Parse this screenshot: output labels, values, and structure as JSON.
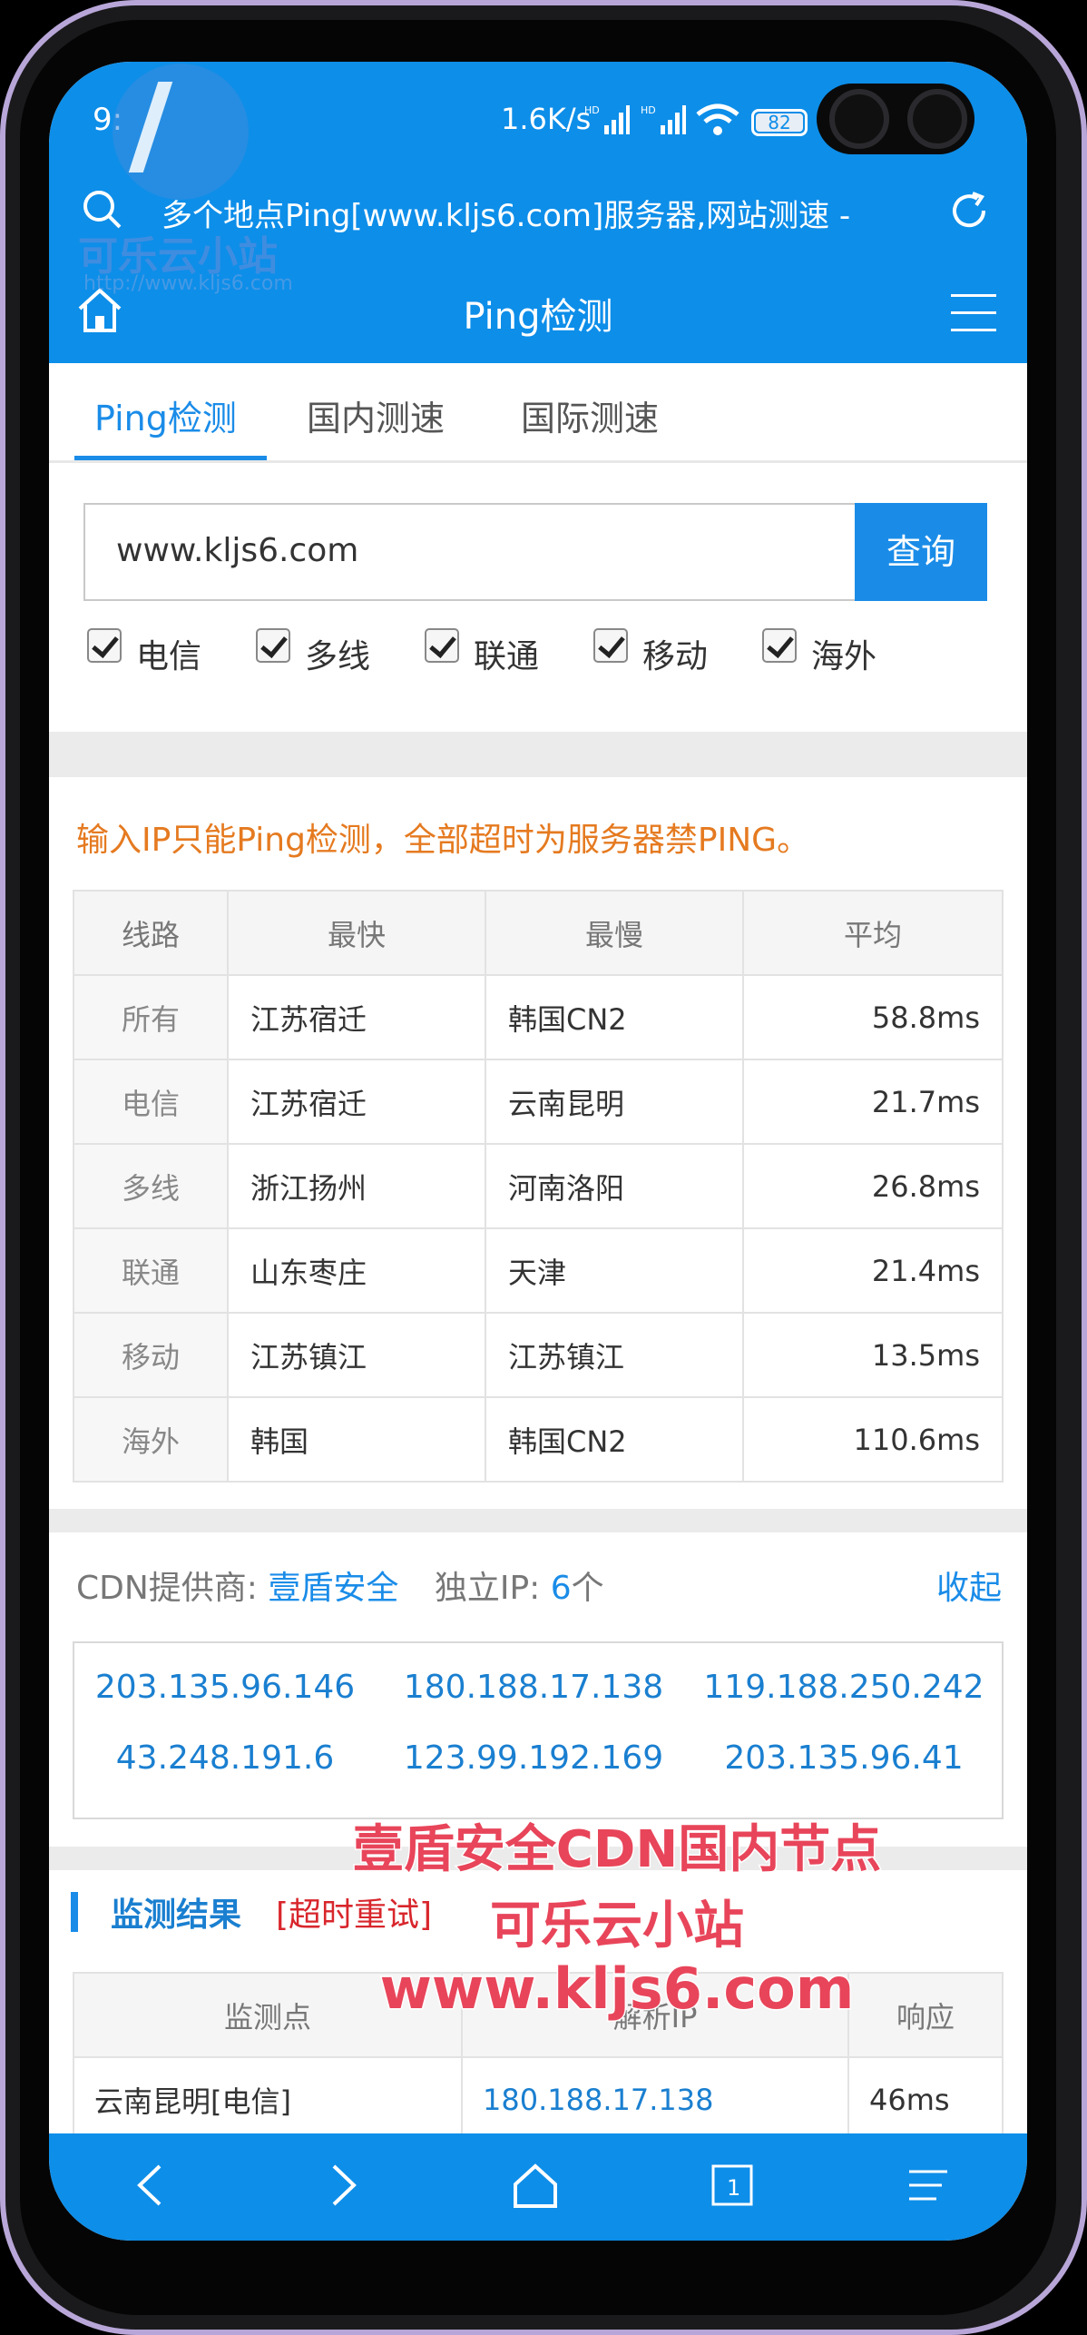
{
  "status_bar": {
    "time": "9:",
    "net_speed": "1.6K/s",
    "battery": "82"
  },
  "url_bar": {
    "text": "多个地点Ping[www.kljs6.com]服务器,网站测速 -"
  },
  "nav": {
    "title": "Ping检测"
  },
  "tabs": [
    {
      "label": "Ping检测",
      "active": true
    },
    {
      "label": "国内测速",
      "active": false
    },
    {
      "label": "国际测速",
      "active": false
    }
  ],
  "search": {
    "value": "www.kljs6.com",
    "button": "查询"
  },
  "checkboxes": [
    {
      "label": "电信",
      "checked": true
    },
    {
      "label": "多线",
      "checked": true
    },
    {
      "label": "联通",
      "checked": true
    },
    {
      "label": "移动",
      "checked": true
    },
    {
      "label": "海外",
      "checked": true
    }
  ],
  "notice": "输入IP只能Ping检测，全部超时为服务器禁PING。",
  "result_table": {
    "headers": [
      "线路",
      "最快",
      "最慢",
      "平均"
    ],
    "rows": [
      [
        "所有",
        "江苏宿迁",
        "韩国CN2",
        "58.8ms"
      ],
      [
        "电信",
        "江苏宿迁",
        "云南昆明",
        "21.7ms"
      ],
      [
        "多线",
        "浙江扬州",
        "河南洛阳",
        "26.8ms"
      ],
      [
        "联通",
        "山东枣庄",
        "天津",
        "21.4ms"
      ],
      [
        "移动",
        "江苏镇江",
        "江苏镇江",
        "13.5ms"
      ],
      [
        "海外",
        "韩国",
        "韩国CN2",
        "110.6ms"
      ]
    ]
  },
  "cdn": {
    "label": "CDN提供商:",
    "provider": "壹盾安全",
    "ip_label": "独立IP:",
    "ip_count": "6",
    "ip_unit": "个",
    "collapse": "收起",
    "ips": [
      "203.135.96.146",
      "180.188.17.138",
      "119.188.250.242",
      "43.248.191.6",
      "123.99.192.169",
      "203.135.96.41"
    ]
  },
  "monitor": {
    "title": "监测结果",
    "retry": "[超时重试]",
    "headers": [
      "监测点",
      "解析IP",
      "响应"
    ],
    "rows": [
      [
        "云南昆明[电信]",
        "180.188.17.138",
        "46ms"
      ]
    ]
  },
  "watermark": {
    "logo_text": "可乐云小站",
    "logo_sub": "http://www.kljs6.com",
    "line1": "壹盾安全CDN国内节点",
    "line2": "可乐云小站",
    "line3": "www.kljs6.com"
  },
  "colors": {
    "brand_blue": "#0d8ee9",
    "link_blue": "#1a7fd0",
    "notice_orange": "#e57a20",
    "retry_red": "#d8262c",
    "overlay_red": "#e8455a"
  },
  "icons": {
    "url_left": "search-icon",
    "url_right": "reload-icon",
    "nav_left": "home-icon",
    "nav_right": "menu-icon",
    "bottom": [
      "back-icon",
      "forward-icon",
      "home-icon",
      "tabs-icon",
      "menu-icon"
    ]
  }
}
